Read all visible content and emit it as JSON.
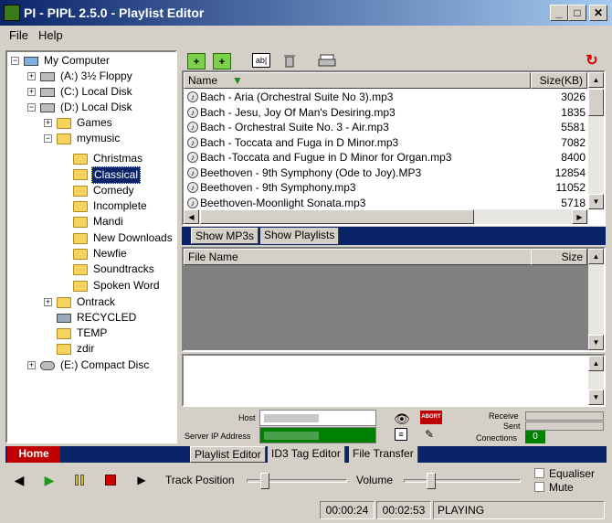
{
  "window": {
    "title": "PI - PIPL 2.5.0 - Playlist Editor",
    "minimize": "_",
    "maximize": "□",
    "close": "✕"
  },
  "menu": {
    "file": "File",
    "help": "Help"
  },
  "tree": {
    "root": "My Computer",
    "items": [
      {
        "label": "(A:)  3½ Floppy"
      },
      {
        "label": "(C:)  Local Disk"
      },
      {
        "label": "(D:)  Local Disk"
      },
      {
        "label": "Games"
      },
      {
        "label": "mymusic"
      },
      {
        "label": "Christmas"
      },
      {
        "label": "Classical"
      },
      {
        "label": "Comedy"
      },
      {
        "label": "Incomplete"
      },
      {
        "label": "Mandi"
      },
      {
        "label": "New Downloads"
      },
      {
        "label": "Newfie"
      },
      {
        "label": "Soundtracks"
      },
      {
        "label": "Spoken Word"
      },
      {
        "label": "Ontrack"
      },
      {
        "label": "RECYCLED"
      },
      {
        "label": "TEMP"
      },
      {
        "label": "zdir"
      },
      {
        "label": "(E:)  Compact Disc"
      }
    ]
  },
  "toolbar": {
    "rename_label": "ab|"
  },
  "files": {
    "col_name": "Name",
    "col_size": "Size(KB)",
    "rows": [
      {
        "name": "Bach - Aria (Orchestral Suite No 3).mp3",
        "size": "3026"
      },
      {
        "name": "Bach - Jesu, Joy Of Man's Desiring.mp3",
        "size": "1835"
      },
      {
        "name": "Bach - Orchestral Suite No. 3 - Air.mp3",
        "size": "5581"
      },
      {
        "name": "Bach - Toccata and Fuga in D Minor.mp3",
        "size": "7082"
      },
      {
        "name": "Bach -Toccata and Fugue in D Minor for Organ.mp3",
        "size": "8400"
      },
      {
        "name": "Beethoven - 9th Symphony (Ode to Joy).MP3",
        "size": "12854"
      },
      {
        "name": "Beethoven - 9th Symphony.mp3",
        "size": "11052"
      },
      {
        "name": "Beethoven-Moonlight Sonata.mp3",
        "size": "5718"
      }
    ]
  },
  "tabs_top": {
    "mp3s": "Show MP3s",
    "playlists": "Show Playlists"
  },
  "playlist": {
    "col_file": "File Name",
    "col_size": "Size"
  },
  "network": {
    "host_label": "Host",
    "server_ip_label": "Server IP Address",
    "abort": "ABORT",
    "receive": "Receive",
    "sent": "Sent",
    "connections": "Conections",
    "connections_value": "0"
  },
  "tabs_bottom": {
    "home": "Home",
    "playlist_editor": "Playlist Editor",
    "id3": "ID3 Tag Editor",
    "transfer": "File Transfer"
  },
  "player": {
    "track_position": "Track Position",
    "volume": "Volume",
    "equaliser": "Equaliser",
    "mute": "Mute",
    "time_elapsed": "00:00:24",
    "time_total": "00:02:53",
    "status": "PLAYING",
    "track_progress": 0.14,
    "volume_level": 0.2
  },
  "colors": {
    "title_start": "#0a246a",
    "home_tab": "#c00000",
    "playlist_bg": "#808080",
    "green_ok": "#008000"
  }
}
